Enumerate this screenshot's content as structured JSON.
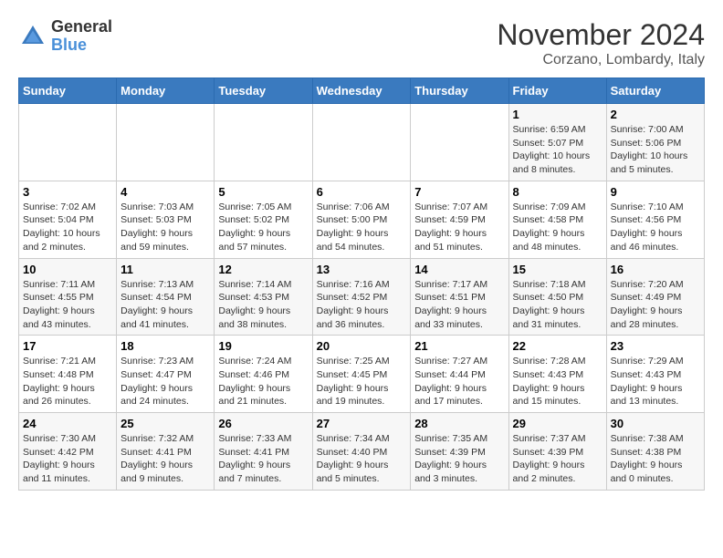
{
  "header": {
    "logo_general": "General",
    "logo_blue": "Blue",
    "month_title": "November 2024",
    "subtitle": "Corzano, Lombardy, Italy"
  },
  "weekdays": [
    "Sunday",
    "Monday",
    "Tuesday",
    "Wednesday",
    "Thursday",
    "Friday",
    "Saturday"
  ],
  "weeks": [
    [
      {
        "day": "",
        "info": ""
      },
      {
        "day": "",
        "info": ""
      },
      {
        "day": "",
        "info": ""
      },
      {
        "day": "",
        "info": ""
      },
      {
        "day": "",
        "info": ""
      },
      {
        "day": "1",
        "info": "Sunrise: 6:59 AM\nSunset: 5:07 PM\nDaylight: 10 hours and 8 minutes."
      },
      {
        "day": "2",
        "info": "Sunrise: 7:00 AM\nSunset: 5:06 PM\nDaylight: 10 hours and 5 minutes."
      }
    ],
    [
      {
        "day": "3",
        "info": "Sunrise: 7:02 AM\nSunset: 5:04 PM\nDaylight: 10 hours and 2 minutes."
      },
      {
        "day": "4",
        "info": "Sunrise: 7:03 AM\nSunset: 5:03 PM\nDaylight: 9 hours and 59 minutes."
      },
      {
        "day": "5",
        "info": "Sunrise: 7:05 AM\nSunset: 5:02 PM\nDaylight: 9 hours and 57 minutes."
      },
      {
        "day": "6",
        "info": "Sunrise: 7:06 AM\nSunset: 5:00 PM\nDaylight: 9 hours and 54 minutes."
      },
      {
        "day": "7",
        "info": "Sunrise: 7:07 AM\nSunset: 4:59 PM\nDaylight: 9 hours and 51 minutes."
      },
      {
        "day": "8",
        "info": "Sunrise: 7:09 AM\nSunset: 4:58 PM\nDaylight: 9 hours and 48 minutes."
      },
      {
        "day": "9",
        "info": "Sunrise: 7:10 AM\nSunset: 4:56 PM\nDaylight: 9 hours and 46 minutes."
      }
    ],
    [
      {
        "day": "10",
        "info": "Sunrise: 7:11 AM\nSunset: 4:55 PM\nDaylight: 9 hours and 43 minutes."
      },
      {
        "day": "11",
        "info": "Sunrise: 7:13 AM\nSunset: 4:54 PM\nDaylight: 9 hours and 41 minutes."
      },
      {
        "day": "12",
        "info": "Sunrise: 7:14 AM\nSunset: 4:53 PM\nDaylight: 9 hours and 38 minutes."
      },
      {
        "day": "13",
        "info": "Sunrise: 7:16 AM\nSunset: 4:52 PM\nDaylight: 9 hours and 36 minutes."
      },
      {
        "day": "14",
        "info": "Sunrise: 7:17 AM\nSunset: 4:51 PM\nDaylight: 9 hours and 33 minutes."
      },
      {
        "day": "15",
        "info": "Sunrise: 7:18 AM\nSunset: 4:50 PM\nDaylight: 9 hours and 31 minutes."
      },
      {
        "day": "16",
        "info": "Sunrise: 7:20 AM\nSunset: 4:49 PM\nDaylight: 9 hours and 28 minutes."
      }
    ],
    [
      {
        "day": "17",
        "info": "Sunrise: 7:21 AM\nSunset: 4:48 PM\nDaylight: 9 hours and 26 minutes."
      },
      {
        "day": "18",
        "info": "Sunrise: 7:23 AM\nSunset: 4:47 PM\nDaylight: 9 hours and 24 minutes."
      },
      {
        "day": "19",
        "info": "Sunrise: 7:24 AM\nSunset: 4:46 PM\nDaylight: 9 hours and 21 minutes."
      },
      {
        "day": "20",
        "info": "Sunrise: 7:25 AM\nSunset: 4:45 PM\nDaylight: 9 hours and 19 minutes."
      },
      {
        "day": "21",
        "info": "Sunrise: 7:27 AM\nSunset: 4:44 PM\nDaylight: 9 hours and 17 minutes."
      },
      {
        "day": "22",
        "info": "Sunrise: 7:28 AM\nSunset: 4:43 PM\nDaylight: 9 hours and 15 minutes."
      },
      {
        "day": "23",
        "info": "Sunrise: 7:29 AM\nSunset: 4:43 PM\nDaylight: 9 hours and 13 minutes."
      }
    ],
    [
      {
        "day": "24",
        "info": "Sunrise: 7:30 AM\nSunset: 4:42 PM\nDaylight: 9 hours and 11 minutes."
      },
      {
        "day": "25",
        "info": "Sunrise: 7:32 AM\nSunset: 4:41 PM\nDaylight: 9 hours and 9 minutes."
      },
      {
        "day": "26",
        "info": "Sunrise: 7:33 AM\nSunset: 4:41 PM\nDaylight: 9 hours and 7 minutes."
      },
      {
        "day": "27",
        "info": "Sunrise: 7:34 AM\nSunset: 4:40 PM\nDaylight: 9 hours and 5 minutes."
      },
      {
        "day": "28",
        "info": "Sunrise: 7:35 AM\nSunset: 4:39 PM\nDaylight: 9 hours and 3 minutes."
      },
      {
        "day": "29",
        "info": "Sunrise: 7:37 AM\nSunset: 4:39 PM\nDaylight: 9 hours and 2 minutes."
      },
      {
        "day": "30",
        "info": "Sunrise: 7:38 AM\nSunset: 4:38 PM\nDaylight: 9 hours and 0 minutes."
      }
    ]
  ]
}
